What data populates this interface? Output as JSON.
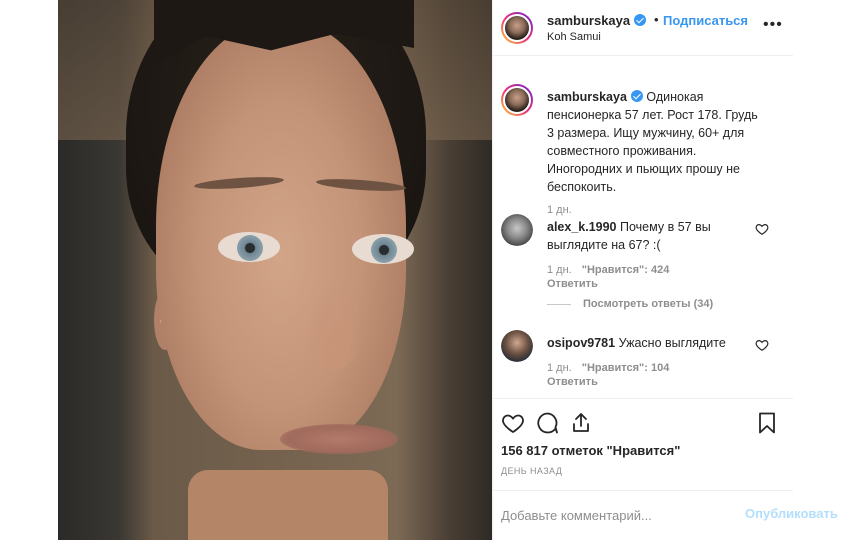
{
  "header": {
    "username": "samburskaya",
    "follow_label": "Подписаться",
    "location": "Koh Samui",
    "dot": "•",
    "more": "•••"
  },
  "caption": {
    "username": "samburskaya",
    "text": "Одинокая пенсионерка 57 лет. Рост 178. Грудь 3 размера. Ищу мужчину, 60+ для совместного проживания. Иногородних и пьющих прошу не беспокоить.",
    "time": "1 дн."
  },
  "comments": [
    {
      "username": "alex_k.1990",
      "text": "Почему в 57 вы выглядите на 67? :(",
      "time": "1 дн.",
      "likes": "\"Нравится\": 424",
      "reply": "Ответить",
      "view_replies": "Посмотреть ответы (34)"
    },
    {
      "username": "osipov9781",
      "text": "Ужасно выглядите",
      "time": "1 дн.",
      "likes": "\"Нравится\": 104",
      "reply": "Ответить"
    }
  ],
  "stats": {
    "likes": "156 817 отметок \"Нравится\"",
    "timestamp": "ДЕНЬ НАЗАД"
  },
  "add_comment": {
    "placeholder": "Добавьте комментарий...",
    "post_label": "Опубликовать"
  },
  "icons": {
    "verified": "verified-badge-icon",
    "like": "heart-icon",
    "comment": "comment-icon",
    "share": "share-icon",
    "save": "bookmark-icon"
  },
  "colors": {
    "link": "#3897f0",
    "muted": "#8e8e8e",
    "post_disabled": "#b2dffc",
    "text": "#262626"
  }
}
